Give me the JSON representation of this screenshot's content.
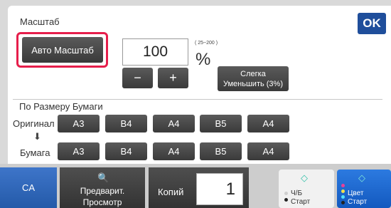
{
  "title": "Масштаб",
  "ok_label": "OK",
  "auto_scale_label": "Авто Масштаб",
  "scale_value": "100",
  "scale_range": "( 25~200 )",
  "percent_sign": "%",
  "minus_label": "−",
  "plus_label": "+",
  "reduce_line1": "Слегка",
  "reduce_line2": "Уменьшить (3%)",
  "paper_section_title": "По Размеру Бумаги",
  "original_label": "Оригинал",
  "paper_label": "Бумага",
  "arrow_glyph": "⬇",
  "original_sizes": [
    "A3",
    "B4",
    "A4",
    "B5",
    "A4"
  ],
  "paper_sizes": [
    "A3",
    "B4",
    "A4",
    "B5",
    "A4"
  ],
  "bottom": {
    "ca_label": "CA",
    "preview_line1": "Предварит.",
    "preview_line2": "Просмотр",
    "preview_icon": "🔍",
    "copies_label": "Копий",
    "copies_value": "1",
    "bw_line1": "Ч/Б",
    "bw_line2": "Старт",
    "color_line1": "Цвет",
    "color_line2": "Старт",
    "start_icon": "◇"
  },
  "colors": {
    "accent_blue": "#1f4e9b",
    "highlight_red": "#e61e4b",
    "button_dark": "#3a3a3a"
  }
}
